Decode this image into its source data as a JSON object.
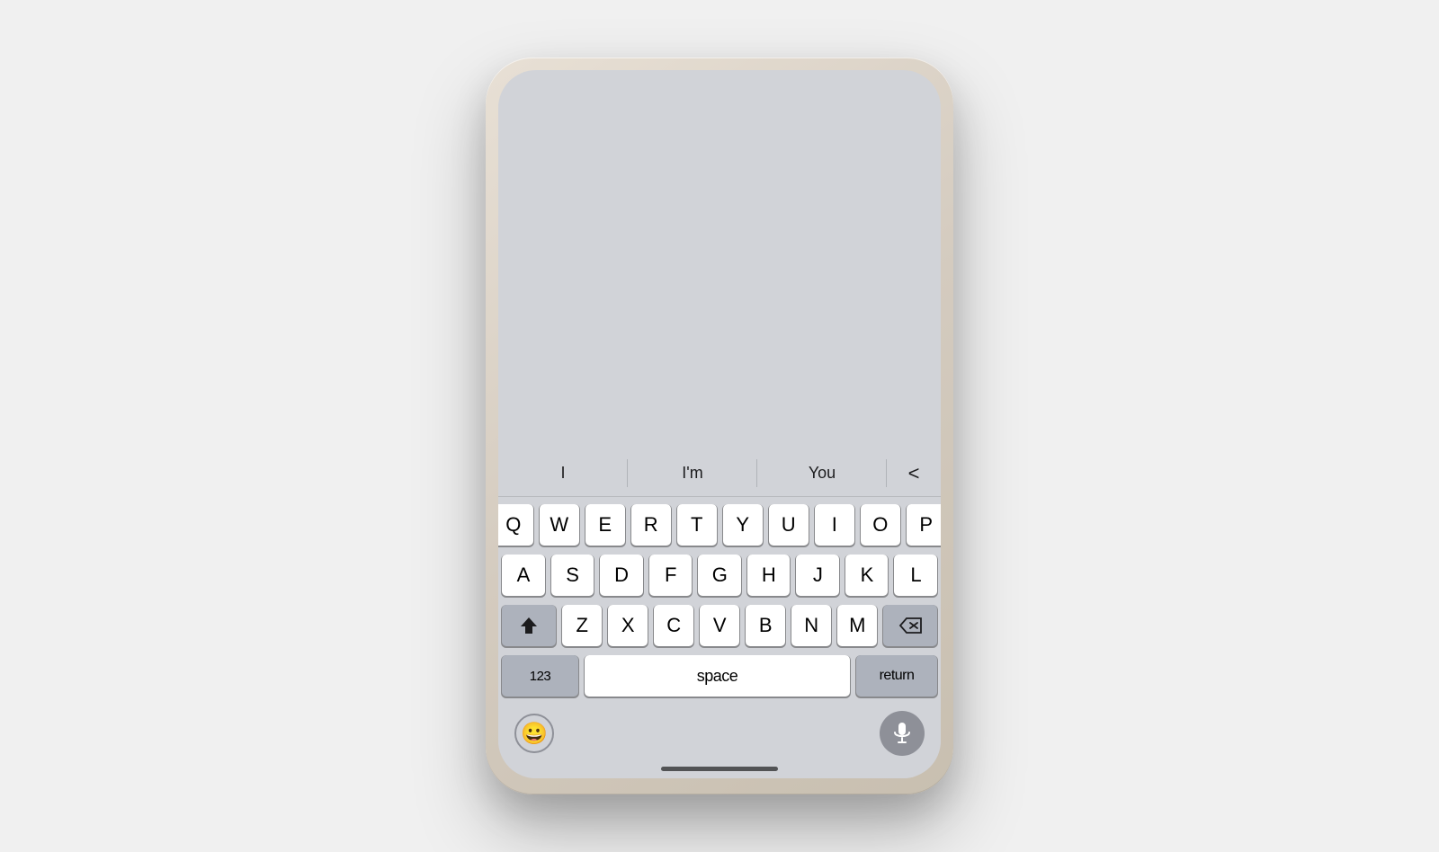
{
  "phone": {
    "keyboard": {
      "predictive": {
        "items": [
          "I",
          "I'm",
          "You"
        ],
        "back_arrow": "‹"
      },
      "rows": [
        [
          "Q",
          "W",
          "E",
          "R",
          "T",
          "Y",
          "U",
          "I",
          "O",
          "P"
        ],
        [
          "A",
          "S",
          "D",
          "F",
          "G",
          "H",
          "J",
          "K",
          "L"
        ],
        [
          "Z",
          "X",
          "C",
          "V",
          "B",
          "N",
          "M"
        ]
      ],
      "bottom_row": {
        "numbers_label": "123",
        "space_label": "space",
        "return_label": "return"
      },
      "emoji_icon": "😀",
      "mic_icon": "🎤"
    }
  },
  "colors": {
    "keyboard_bg": "#d1d3d8",
    "key_bg": "#ffffff",
    "special_key_bg": "#adb2bc",
    "phone_bezel": "#d4cbbf",
    "screen_bg": "#d1d3d8"
  }
}
